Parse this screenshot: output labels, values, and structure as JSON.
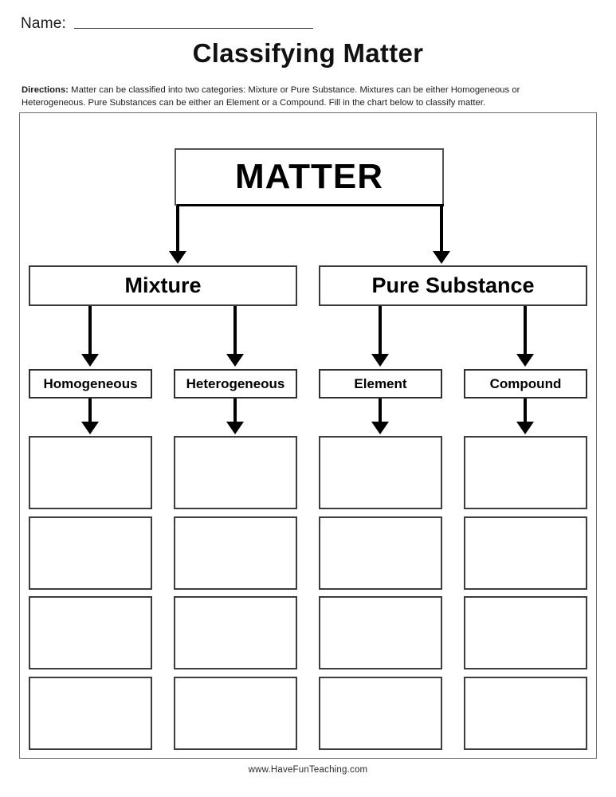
{
  "header": {
    "name_label": "Name:",
    "title": "Classifying Matter",
    "directions_lead": "Directions:",
    "directions_text": " Matter can be classified into two categories: Mixture or Pure Substance. Mixtures can be either Homogeneous or Heterogeneous. Pure Substances can be either an Element or a Compound. Fill in the chart below to classify matter."
  },
  "chart_data": {
    "type": "diagram",
    "title": "Classifying Matter",
    "root": "MATTER",
    "level2": [
      "Mixture",
      "Pure Substance"
    ],
    "level3": [
      "Homogeneous",
      "Heterogeneous",
      "Element",
      "Compound"
    ],
    "answer_rows": 4,
    "answer_columns": 4,
    "answer_cells": [
      [
        "",
        "",
        "",
        ""
      ],
      [
        "",
        "",
        "",
        ""
      ],
      [
        "",
        "",
        "",
        ""
      ],
      [
        "",
        "",
        "",
        ""
      ]
    ]
  },
  "footer": {
    "url": "www.HaveFunTeaching.com"
  }
}
